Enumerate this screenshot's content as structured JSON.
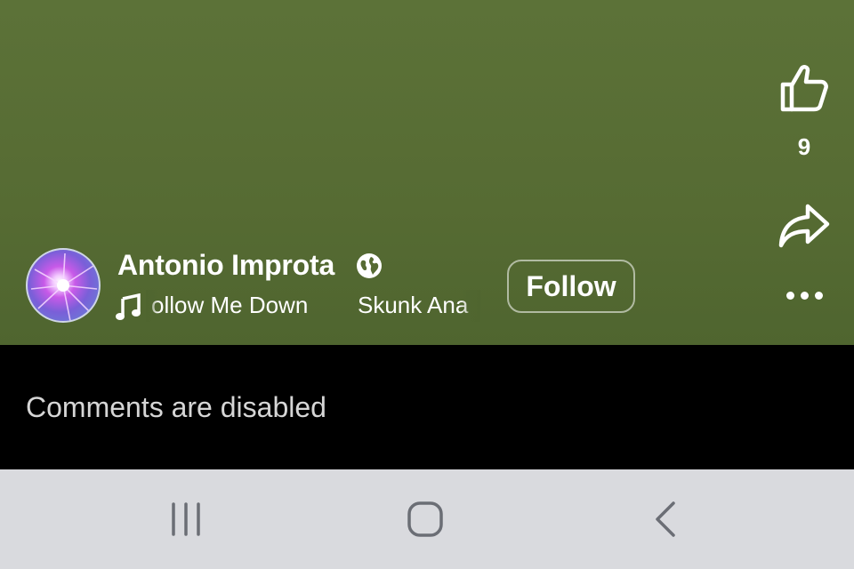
{
  "video": {
    "like_count": "9",
    "icons": {
      "like": "thumbs-up-icon",
      "share": "share-arrow-icon",
      "more": "more-dots-icon"
    }
  },
  "author": {
    "name": "Antonio Improta",
    "visibility_icon": "globe-icon",
    "follow_label": "Follow"
  },
  "music": {
    "icon": "music-note-icon",
    "title": "ollow Me Down",
    "artist": "Skunk Ana"
  },
  "comments": {
    "status": "Comments are disabled"
  },
  "navbar": {
    "icons": [
      "recents-icon",
      "home-icon",
      "back-icon"
    ]
  },
  "colors": {
    "video_bg": "#566b33",
    "comments_bg": "#000000",
    "navbar_bg": "#d9dade",
    "nav_icon": "#6b6e75"
  }
}
